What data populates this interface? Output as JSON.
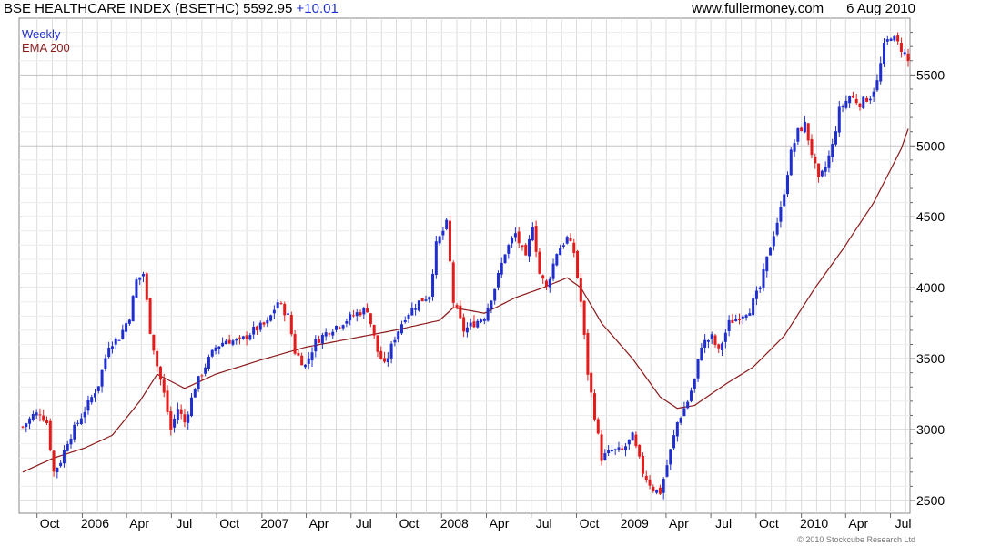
{
  "header": {
    "title": "BSE HEALTHCARE INDEX (BSETHC) 5592.95",
    "change": "+10.01",
    "site": "www.fullermoney.com",
    "date": "6 Aug 2010"
  },
  "legend": {
    "weekly": "Weekly",
    "ema": "EMA 200"
  },
  "copyright": "© 2010 Stockcube Research Ltd",
  "colors": {
    "up": "#1f2fcf",
    "down": "#e31b1b",
    "ema": "#8b1a1a",
    "grid": "#dcdcdc"
  },
  "chart_data": {
    "type": "candlestick",
    "x_range": [
      "2005-09-02",
      "2010-08-06"
    ],
    "ylim": [
      2410,
      5900
    ],
    "yticks": [
      2500,
      3000,
      3500,
      4000,
      4500,
      5000,
      5500
    ],
    "xticks": [
      {
        "label": "Oct",
        "date": "2005-10-01"
      },
      {
        "label": "2006",
        "date": "2006-01-01"
      },
      {
        "label": "Apr",
        "date": "2006-04-01"
      },
      {
        "label": "Jul",
        "date": "2006-07-01"
      },
      {
        "label": "Oct",
        "date": "2006-10-01"
      },
      {
        "label": "2007",
        "date": "2007-01-01"
      },
      {
        "label": "Apr",
        "date": "2007-04-01"
      },
      {
        "label": "Jul",
        "date": "2007-07-01"
      },
      {
        "label": "Oct",
        "date": "2007-10-01"
      },
      {
        "label": "2008",
        "date": "2008-01-01"
      },
      {
        "label": "Apr",
        "date": "2008-04-01"
      },
      {
        "label": "Jul",
        "date": "2008-07-01"
      },
      {
        "label": "Oct",
        "date": "2008-10-01"
      },
      {
        "label": "2009",
        "date": "2009-01-01"
      },
      {
        "label": "Apr",
        "date": "2009-04-01"
      },
      {
        "label": "Jul",
        "date": "2009-07-01"
      },
      {
        "label": "Oct",
        "date": "2009-10-01"
      },
      {
        "label": "2010",
        "date": "2010-01-01"
      },
      {
        "label": "Apr",
        "date": "2010-04-01"
      },
      {
        "label": "Jul",
        "date": "2010-07-01"
      }
    ],
    "grid": true,
    "close_path": [
      [
        "2005-09-02",
        3020
      ],
      [
        "2005-09-23",
        3100
      ],
      [
        "2005-10-07",
        3120
      ],
      [
        "2005-10-21",
        3050
      ],
      [
        "2005-11-04",
        2700
      ],
      [
        "2005-11-18",
        2780
      ],
      [
        "2005-12-02",
        2920
      ],
      [
        "2005-12-23",
        3050
      ],
      [
        "2006-01-13",
        3180
      ],
      [
        "2006-02-03",
        3320
      ],
      [
        "2006-02-24",
        3600
      ],
      [
        "2006-03-17",
        3650
      ],
      [
        "2006-04-07",
        3800
      ],
      [
        "2006-04-21",
        4050
      ],
      [
        "2006-05-05",
        4100
      ],
      [
        "2006-05-19",
        3700
      ],
      [
        "2006-06-02",
        3450
      ],
      [
        "2006-06-16",
        3250
      ],
      [
        "2006-06-30",
        3000
      ],
      [
        "2006-07-14",
        3150
      ],
      [
        "2006-07-28",
        3050
      ],
      [
        "2006-08-18",
        3300
      ],
      [
        "2006-09-08",
        3450
      ],
      [
        "2006-09-29",
        3580
      ],
      [
        "2006-10-20",
        3630
      ],
      [
        "2006-11-17",
        3620
      ],
      [
        "2006-12-15",
        3700
      ],
      [
        "2007-01-12",
        3750
      ],
      [
        "2007-02-02",
        3900
      ],
      [
        "2007-02-23",
        3800
      ],
      [
        "2007-03-09",
        3550
      ],
      [
        "2007-03-30",
        3450
      ],
      [
        "2007-04-20",
        3620
      ],
      [
        "2007-05-18",
        3700
      ],
      [
        "2007-06-15",
        3760
      ],
      [
        "2007-07-13",
        3820
      ],
      [
        "2007-08-03",
        3850
      ],
      [
        "2007-08-24",
        3550
      ],
      [
        "2007-09-07",
        3450
      ],
      [
        "2007-09-28",
        3650
      ],
      [
        "2007-10-19",
        3800
      ],
      [
        "2007-11-16",
        3900
      ],
      [
        "2007-12-07",
        3950
      ],
      [
        "2007-12-21",
        4300
      ],
      [
        "2008-01-11",
        4450
      ],
      [
        "2008-01-25",
        3900
      ],
      [
        "2008-02-15",
        3700
      ],
      [
        "2008-03-07",
        3750
      ],
      [
        "2008-03-28",
        3800
      ],
      [
        "2008-04-18",
        4000
      ],
      [
        "2008-05-09",
        4250
      ],
      [
        "2008-05-30",
        4380
      ],
      [
        "2008-06-20",
        4200
      ],
      [
        "2008-07-04",
        4450
      ],
      [
        "2008-07-18",
        4100
      ],
      [
        "2008-08-01",
        4000
      ],
      [
        "2008-08-22",
        4250
      ],
      [
        "2008-09-12",
        4350
      ],
      [
        "2008-09-26",
        4250
      ],
      [
        "2008-10-10",
        3900
      ],
      [
        "2008-10-24",
        3400
      ],
      [
        "2008-11-07",
        3100
      ],
      [
        "2008-11-21",
        2800
      ],
      [
        "2008-12-12",
        2850
      ],
      [
        "2009-01-02",
        2850
      ],
      [
        "2009-01-23",
        2950
      ],
      [
        "2009-02-13",
        2700
      ],
      [
        "2009-03-06",
        2580
      ],
      [
        "2009-03-20",
        2560
      ],
      [
        "2009-04-03",
        2750
      ],
      [
        "2009-04-24",
        3050
      ],
      [
        "2009-05-15",
        3200
      ],
      [
        "2009-05-29",
        3350
      ],
      [
        "2009-06-12",
        3600
      ],
      [
        "2009-07-03",
        3650
      ],
      [
        "2009-07-17",
        3550
      ],
      [
        "2009-08-07",
        3750
      ],
      [
        "2009-08-28",
        3800
      ],
      [
        "2009-09-18",
        3850
      ],
      [
        "2009-10-09",
        4000
      ],
      [
        "2009-10-30",
        4300
      ],
      [
        "2009-11-20",
        4550
      ],
      [
        "2009-12-11",
        4950
      ],
      [
        "2009-12-25",
        5100
      ],
      [
        "2010-01-08",
        5150
      ],
      [
        "2010-01-22",
        4950
      ],
      [
        "2010-02-05",
        4750
      ],
      [
        "2010-02-19",
        4850
      ],
      [
        "2010-03-05",
        5000
      ],
      [
        "2010-03-19",
        5250
      ],
      [
        "2010-04-09",
        5350
      ],
      [
        "2010-04-30",
        5300
      ],
      [
        "2010-05-21",
        5350
      ],
      [
        "2010-06-04",
        5450
      ],
      [
        "2010-06-18",
        5700
      ],
      [
        "2010-07-02",
        5780
      ],
      [
        "2010-07-16",
        5720
      ],
      [
        "2010-07-30",
        5650
      ],
      [
        "2010-08-06",
        5593
      ]
    ],
    "ema_path": [
      [
        "2005-09-02",
        2700
      ],
      [
        "2005-11-04",
        2800
      ],
      [
        "2006-01-06",
        2870
      ],
      [
        "2006-03-03",
        2960
      ],
      [
        "2006-04-28",
        3200
      ],
      [
        "2006-06-02",
        3390
      ],
      [
        "2006-07-28",
        3290
      ],
      [
        "2006-09-29",
        3390
      ],
      [
        "2006-12-29",
        3490
      ],
      [
        "2007-03-30",
        3580
      ],
      [
        "2007-06-29",
        3640
      ],
      [
        "2007-09-28",
        3700
      ],
      [
        "2007-12-28",
        3770
      ],
      [
        "2008-01-25",
        3860
      ],
      [
        "2008-03-28",
        3820
      ],
      [
        "2008-05-30",
        3930
      ],
      [
        "2008-07-25",
        4000
      ],
      [
        "2008-09-12",
        4070
      ],
      [
        "2008-10-10",
        4000
      ],
      [
        "2008-11-21",
        3750
      ],
      [
        "2009-01-23",
        3500
      ],
      [
        "2009-03-20",
        3230
      ],
      [
        "2009-04-24",
        3150
      ],
      [
        "2009-05-29",
        3170
      ],
      [
        "2009-07-31",
        3320
      ],
      [
        "2009-09-25",
        3440
      ],
      [
        "2009-11-27",
        3660
      ],
      [
        "2010-01-29",
        4000
      ],
      [
        "2010-03-26",
        4270
      ],
      [
        "2010-05-28",
        4600
      ],
      [
        "2010-07-23",
        4980
      ],
      [
        "2010-08-06",
        5120
      ]
    ]
  }
}
